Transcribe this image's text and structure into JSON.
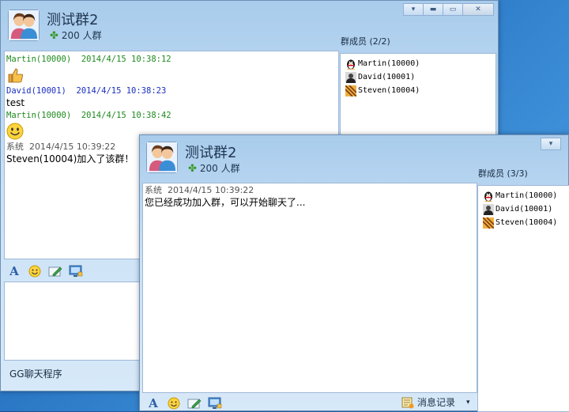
{
  "win_a": {
    "title": "测试群2",
    "subtitle": "200 人群",
    "members_label": "群成员 (2/2)",
    "members": [
      {
        "name": "Martin(10000)",
        "icon": "penguin-icon"
      },
      {
        "name": "David(10001)",
        "icon": "avatar-icon"
      },
      {
        "name": "Steven(10004)",
        "icon": "avatar-icon"
      }
    ],
    "messages": [
      {
        "sender": "Martin(10000)",
        "time": "2014/4/15 10:38:12",
        "body_icon": "thumbs-up-icon"
      },
      {
        "sender": "David(10001)",
        "time": "2014/4/15 10:38:23",
        "body": "test"
      },
      {
        "sender": "Martin(10000)",
        "time": "2014/4/15 10:38:42",
        "body_icon": "smiley-icon"
      },
      {
        "sender": "系统",
        "time": "2014/4/15 10:39:22",
        "body": "Steven(10004)加入了该群！"
      }
    ],
    "footer": "GG聊天程序"
  },
  "win_b": {
    "title": "测试群2",
    "subtitle": "200 人群",
    "members_label": "群成员 (3/3)",
    "members": [
      {
        "name": "Martin(10000)",
        "icon": "penguin-icon"
      },
      {
        "name": "David(10001)",
        "icon": "avatar-icon"
      },
      {
        "name": "Steven(10004)",
        "icon": "avatar-icon"
      }
    ],
    "messages": [
      {
        "sender": "系统",
        "time": "2014/4/15 10:39:22",
        "body": "您已经成功加入群，可以开始聊天了..."
      }
    ],
    "history_label": "消息记录"
  },
  "colors": {
    "sender_green": "#1f8a1f",
    "sender_blue": "#1a2fc2",
    "system_gray": "#555555"
  }
}
